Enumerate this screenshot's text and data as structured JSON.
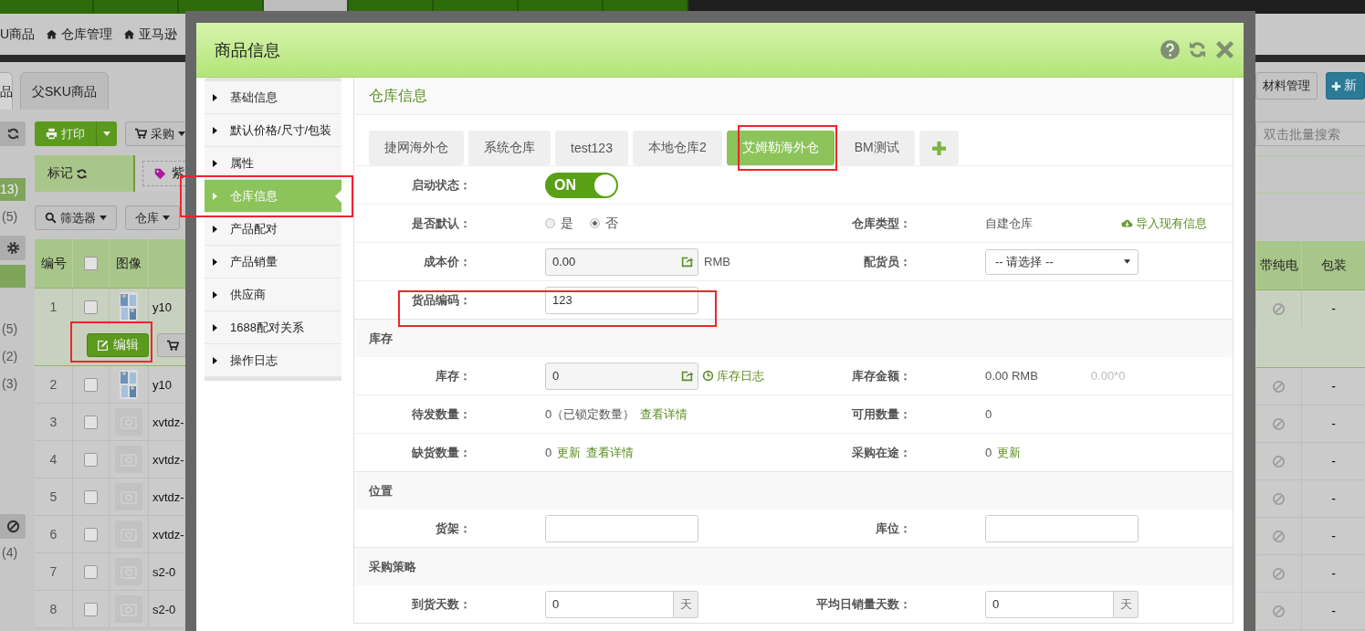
{
  "top_nav": [
    {
      "selected": false
    },
    {
      "selected": false
    },
    {
      "selected": false
    },
    {
      "selected": true
    },
    {
      "selected": false
    },
    {
      "selected": false
    },
    {
      "selected": false
    },
    {
      "selected": false
    }
  ],
  "breadcrumbs": [
    {
      "label": "U商品",
      "kind": "plain"
    },
    {
      "label": "仓库管理",
      "kind": "home"
    },
    {
      "label": "亚马逊",
      "kind": "home"
    }
  ],
  "page_tabs": [
    {
      "label": "品",
      "selected": true
    },
    {
      "label": "父SKU商品",
      "selected": false
    }
  ],
  "side_groups": [
    {
      "highlight": false,
      "counts": [
        {
          "label": "13)",
          "selected": true
        },
        {
          "label": "(5)",
          "selected": false
        }
      ]
    },
    {
      "highlight": true,
      "counts": [
        {
          "label": "(5)",
          "selected": false
        },
        {
          "label": "(2)",
          "selected": false
        },
        {
          "label": "(3)",
          "selected": false
        }
      ]
    },
    {
      "highlight": false,
      "counts": [
        {
          "label": "(4)",
          "selected": false
        }
      ]
    }
  ],
  "toolbar": {
    "print": "打印",
    "purchase": "采购"
  },
  "mark": {
    "label": "标记",
    "tag": "紫"
  },
  "filters": [
    "筛选器",
    "仓库"
  ],
  "table": {
    "columns": [
      "编号",
      "图像"
    ],
    "header_checked": false,
    "right_columns": [
      "带纯电",
      "包装"
    ],
    "row_actions": [
      "编辑"
    ],
    "rows": [
      {
        "no": "1",
        "checked": false,
        "selected": true,
        "sku": "y10",
        "pack": "-"
      },
      {
        "no": "2",
        "checked": false,
        "selected": false,
        "sku": "y10",
        "pack": "-"
      },
      {
        "no": "3",
        "checked": false,
        "selected": false,
        "kind": "placeholder",
        "sku": "xvtdz-",
        "pack": "-"
      },
      {
        "no": "4",
        "checked": false,
        "selected": false,
        "kind": "placeholder",
        "sku": "xvtdz-",
        "pack": "-"
      },
      {
        "no": "5",
        "checked": false,
        "selected": false,
        "kind": "placeholder",
        "sku": "xvtdz-",
        "pack": "-"
      },
      {
        "no": "6",
        "checked": false,
        "selected": false,
        "kind": "placeholder",
        "sku": "xvtdz-",
        "pack": "-"
      },
      {
        "no": "7",
        "checked": false,
        "selected": false,
        "kind": "placeholder",
        "sku": "s2-0",
        "pack": "-"
      },
      {
        "no": "8",
        "checked": false,
        "selected": false,
        "kind": "placeholder",
        "sku": "s2-0",
        "pack": "-"
      }
    ]
  },
  "right_buttons": [
    {
      "label": "材料管理",
      "kind": "default"
    },
    {
      "label": "新",
      "kind": "primary"
    }
  ],
  "search": {
    "placeholder": "双击批量搜索"
  },
  "modal": {
    "title": "商品信息",
    "nav": [
      {
        "label": "基础信息",
        "selected": false
      },
      {
        "label": "默认价格/尺寸/包装",
        "selected": false
      },
      {
        "label": "属性",
        "selected": false
      },
      {
        "label": "仓库信息",
        "selected": true
      },
      {
        "label": "产品配对",
        "selected": false
      },
      {
        "label": "产品销量",
        "selected": false
      },
      {
        "label": "供应商",
        "selected": false
      },
      {
        "label": "1688配对关系",
        "selected": false
      },
      {
        "label": "操作日志",
        "selected": false
      }
    ],
    "panel_title": "仓库信息",
    "warehouse_tabs": [
      {
        "label": "捷网海外仓",
        "selected": false
      },
      {
        "label": "系统仓库",
        "selected": false
      },
      {
        "label": "test123",
        "selected": false
      },
      {
        "label": "本地仓库2",
        "selected": false
      },
      {
        "label": "艾姆勒海外仓",
        "selected": true
      },
      {
        "label": "BM测试",
        "selected": false
      }
    ],
    "sections": [
      {
        "rows": [
          {
            "fields": [
              {
                "label": "启动状态：",
                "kind": "toggle",
                "on": true,
                "text": "ON"
              }
            ]
          },
          {
            "fields": [
              {
                "label": "是否默认：",
                "kind": "radio",
                "options": [
                  {
                    "label": "是",
                    "selected": false
                  },
                  {
                    "label": "否",
                    "selected": true
                  }
                ]
              },
              {
                "label": "仓库类型：",
                "kind": "text",
                "parts": [
                  {
                    "kind": "text",
                    "text": "自建仓库"
                  },
                  {
                    "kind": "import",
                    "text": "导入现有信息"
                  }
                ]
              }
            ]
          },
          {
            "fields": [
              {
                "label": "成本价：",
                "kind": "input",
                "value": "0.00",
                "action": true,
                "parts": [
                  {
                    "kind": "text",
                    "text": "RMB"
                  }
                ]
              },
              {
                "label": "配货员：",
                "kind": "select",
                "value": "-- 请选择 --"
              }
            ]
          },
          {
            "fields": [
              {
                "label": "货品编码：",
                "kind": "input",
                "value": "123",
                "action": false
              }
            ]
          }
        ]
      },
      {
        "title": "库存",
        "rows": [
          {
            "fields": [
              {
                "label": "库存：",
                "kind": "input",
                "value": "0",
                "action": true,
                "parts": [
                  {
                    "kind": "log",
                    "text": "库存日志"
                  }
                ]
              },
              {
                "label": "库存金额：",
                "kind": "text",
                "parts": [
                  {
                    "kind": "text",
                    "text": "0.00 RMB"
                  },
                  {
                    "kind": "muted",
                    "text": "0.00*0"
                  }
                ]
              }
            ]
          },
          {
            "fields": [
              {
                "label": "待发数量：",
                "kind": "text",
                "parts": [
                  {
                    "kind": "text",
                    "text": "0（已锁定数量）"
                  },
                  {
                    "kind": "link",
                    "text": "查看详情"
                  }
                ]
              },
              {
                "label": "可用数量：",
                "kind": "text",
                "parts": [
                  {
                    "kind": "text",
                    "text": "0"
                  }
                ]
              }
            ]
          },
          {
            "fields": [
              {
                "label": "缺货数量：",
                "kind": "text",
                "parts": [
                  {
                    "kind": "text",
                    "text": "0"
                  },
                  {
                    "kind": "link",
                    "text": "更新"
                  },
                  {
                    "kind": "link",
                    "text": "查看详情"
                  }
                ]
              },
              {
                "label": "采购在途：",
                "kind": "text",
                "parts": [
                  {
                    "kind": "text",
                    "text": "0"
                  },
                  {
                    "kind": "link",
                    "text": "更新"
                  }
                ]
              }
            ]
          }
        ]
      },
      {
        "title": "位置",
        "rows": [
          {
            "fields": [
              {
                "label": "货架：",
                "kind": "input",
                "action": false
              },
              {
                "label": "库位：",
                "kind": "input",
                "action": false
              }
            ]
          }
        ]
      },
      {
        "title": "采购策略",
        "rows": [
          {
            "fields": [
              {
                "label": "到货天数：",
                "kind": "input",
                "value": "0",
                "action": false,
                "addon": "天"
              },
              {
                "label": "平均日销量天数：",
                "kind": "input",
                "value": "0",
                "action": false,
                "addon": "天"
              }
            ]
          }
        ]
      }
    ]
  }
}
